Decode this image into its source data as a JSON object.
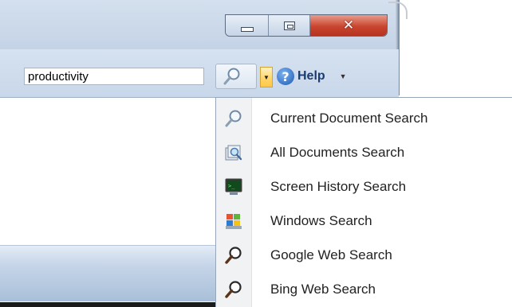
{
  "window": {
    "caption": {
      "minimize": "minimize",
      "maximize": "maximize",
      "close": "close"
    }
  },
  "toolbar": {
    "search_value": "productivity",
    "help_label": "Help"
  },
  "search_menu": {
    "items": [
      {
        "label": "Current Document Search",
        "icon": "magnifier-icon"
      },
      {
        "label": "All Documents Search",
        "icon": "documents-search-icon"
      },
      {
        "label": "Screen History Search",
        "icon": "monitor-icon"
      },
      {
        "label": "Windows Search",
        "icon": "windows-search-icon"
      },
      {
        "label": "Google Web Search",
        "icon": "magnifier-dark-icon"
      },
      {
        "label": "Bing Web Search",
        "icon": "magnifier-dark-icon"
      }
    ]
  },
  "colors": {
    "ribbon": "#c8d7ea",
    "close_button": "#c9452e",
    "search_dropdown_active": "#ffd56a",
    "help_text": "#1c3b70"
  }
}
